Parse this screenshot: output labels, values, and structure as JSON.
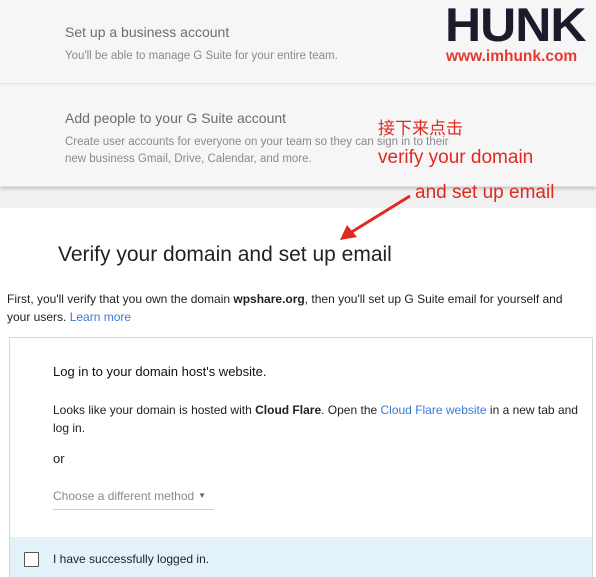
{
  "setup_steps": [
    {
      "title": "Set up a business account",
      "description": "You'll be able to manage G Suite for your entire team."
    },
    {
      "title": "Add people to your G Suite account",
      "description": "Create user accounts for everyone on your team so they can sign in to their new business Gmail, Drive, Calendar, and more."
    }
  ],
  "watermark": {
    "logo": "HUNK",
    "url": "www.imhunk.com"
  },
  "annotations": {
    "line1": "接下来点击",
    "line2": "verify your domain",
    "line3": "and set up email"
  },
  "main": {
    "title": "Verify your domain and set up email",
    "intro_prefix": "First, you'll verify that you own the domain ",
    "domain": "wpshare.org",
    "intro_suffix": ", then you'll set up G Suite email for yourself and your users. ",
    "learn_more": "Learn more"
  },
  "login_box": {
    "title": "Log in to your domain host's website.",
    "text_prefix": "Looks like your domain is hosted with ",
    "host": "Cloud Flare",
    "text_middle": ". Open the ",
    "host_link": "Cloud Flare website",
    "text_suffix": " in a new tab and log in.",
    "or": "or",
    "method_select": "Choose a different method",
    "confirm_label": "I have successfully logged in."
  },
  "colors": {
    "link": "#3a7bd5",
    "annotation": "#e02a1f",
    "confirm_bg": "#e3f1fb"
  }
}
